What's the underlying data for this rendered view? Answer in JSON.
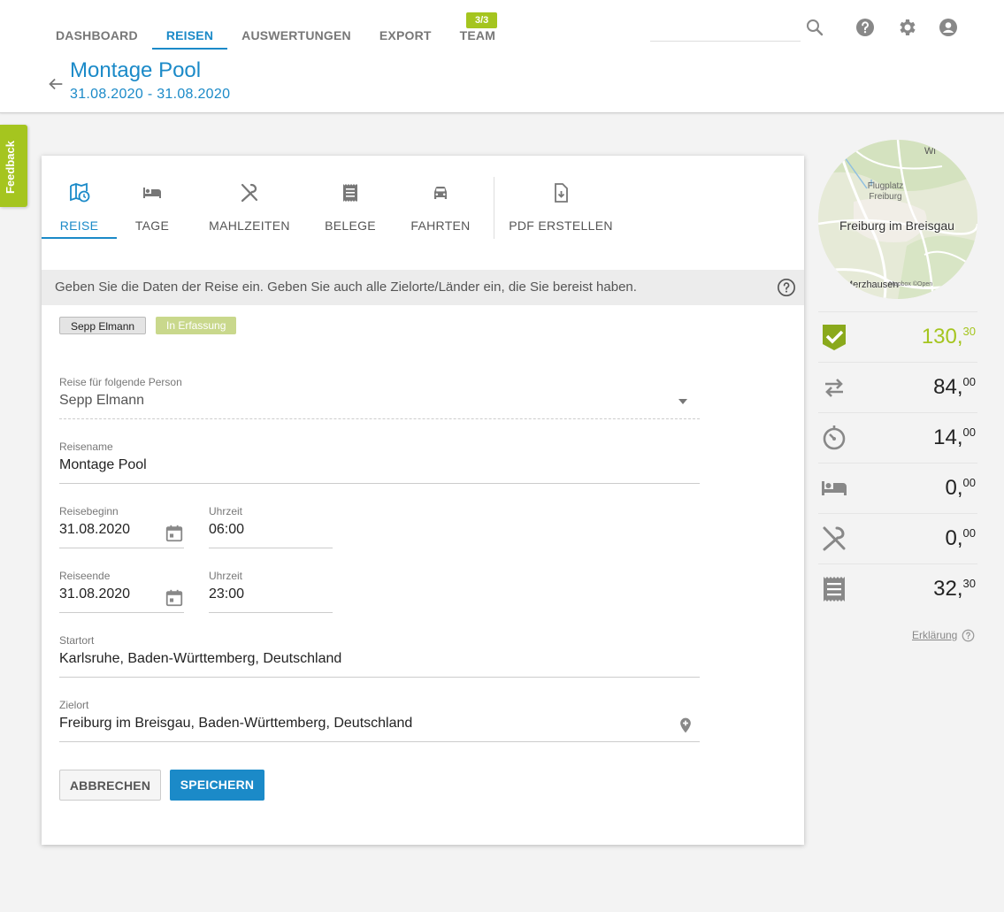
{
  "nav": {
    "items": [
      {
        "label": "DASHBOARD",
        "active": false
      },
      {
        "label": "REISEN",
        "active": true
      },
      {
        "label": "AUSWERTUNGEN",
        "active": false
      },
      {
        "label": "EXPORT",
        "active": false
      },
      {
        "label": "TEAM",
        "active": false
      }
    ],
    "team_badge": "3/3"
  },
  "header": {
    "title": "Montage Pool",
    "date_range": "31.08.2020 - 31.08.2020",
    "icons": [
      "search-icon",
      "help-icon",
      "settings-icon",
      "account-icon"
    ]
  },
  "feedback_label": "Feedback",
  "tabs": [
    {
      "label": "REISE",
      "icon": "map-clock-icon",
      "active": true
    },
    {
      "label": "TAGE",
      "icon": "bed-icon",
      "active": false
    },
    {
      "label": "MAHLZEITEN",
      "icon": "cutlery-icon",
      "active": false
    },
    {
      "label": "BELEGE",
      "icon": "receipt-icon",
      "active": false
    },
    {
      "label": "FAHRTEN",
      "icon": "car-icon",
      "active": false
    },
    {
      "label": "PDF ERSTELLEN",
      "icon": "file-download-icon",
      "active": false
    }
  ],
  "info_text": "Geben Sie die Daten der Reise ein. Geben Sie auch alle Zielorte/Länder ein, die Sie bereist haben.",
  "chips": {
    "person": "Sepp Elmann",
    "status": "In Erfassung"
  },
  "form": {
    "person": {
      "label": "Reise für folgende Person",
      "value": "Sepp Elmann"
    },
    "name": {
      "label": "Reisename",
      "value": "Montage Pool"
    },
    "start_date": {
      "label": "Reisebeginn",
      "value": "31.08.2020"
    },
    "start_time": {
      "label": "Uhrzeit",
      "value": "06:00"
    },
    "end_date": {
      "label": "Reiseende",
      "value": "31.08.2020"
    },
    "end_time": {
      "label": "Uhrzeit",
      "value": "23:00"
    },
    "origin": {
      "label": "Startort",
      "value": "Karlsruhe, Baden-Württemberg, Deutschland"
    },
    "destination": {
      "label": "Zielort",
      "value": "Freiburg im Breisgau, Baden-Württemberg, Deutschland"
    }
  },
  "buttons": {
    "cancel": "ABBRECHEN",
    "save": "SPEICHERN"
  },
  "map": {
    "city_label": "Freiburg im Breisgau",
    "airport_label": "Flugplatz Freiburg",
    "north_label": "Wi",
    "south_label": "Merzhausen",
    "attribution": "Mapbox ©Open"
  },
  "summary": [
    {
      "icon": "approved-badge-icon",
      "main": "130,",
      "cents": "30",
      "total": true
    },
    {
      "icon": "transfer-icon",
      "main": "84,",
      "cents": "00",
      "total": false
    },
    {
      "icon": "timer-icon",
      "main": "14,",
      "cents": "00",
      "total": false
    },
    {
      "icon": "bed-icon",
      "main": "0,",
      "cents": "00",
      "total": false
    },
    {
      "icon": "cutlery-icon",
      "main": "0,",
      "cents": "00",
      "total": false
    },
    {
      "icon": "receipt-icon",
      "main": "32,",
      "cents": "30",
      "total": false
    }
  ],
  "explain_label": "Erklärung",
  "colors": {
    "accent": "#1b8ac8",
    "green": "#a5c51f",
    "status_chip": "#c9d88c"
  }
}
